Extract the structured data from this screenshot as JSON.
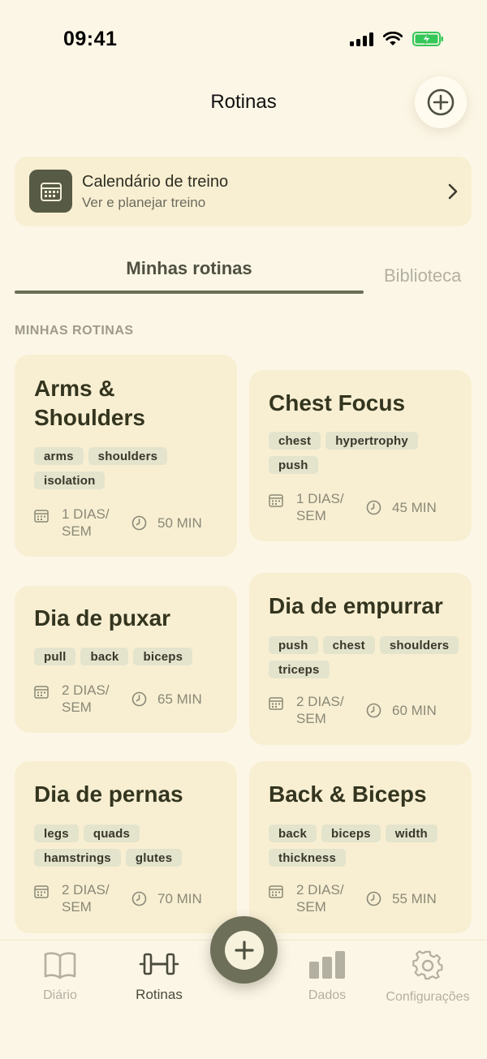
{
  "status_bar": {
    "time": "09:41"
  },
  "header": {
    "title": "Rotinas"
  },
  "calendar_card": {
    "title": "Calendário de treino",
    "subtitle": "Ver e planejar treino"
  },
  "tabs": {
    "mine": "Minhas rotinas",
    "library": "Biblioteca"
  },
  "section_label": "MINHAS ROTINAS",
  "routines": [
    {
      "title": "Arms &\nShoulders",
      "tags": [
        "arms",
        "shoulders",
        "isolation"
      ],
      "days": "1 DIAS/\nSEM",
      "minutes": "50 MIN"
    },
    {
      "title": "Chest Focus",
      "tags": [
        "chest",
        "hypertrophy",
        "push"
      ],
      "days": "1 DIAS/\nSEM",
      "minutes": "45 MIN"
    },
    {
      "title": "Dia de puxar",
      "tags": [
        "pull",
        "back",
        "biceps"
      ],
      "days": "2 DIAS/\nSEM",
      "minutes": "65 MIN"
    },
    {
      "title": "Dia de empurrar",
      "tags": [
        "push",
        "chest",
        "shoulders",
        "triceps"
      ],
      "days": "2 DIAS/\nSEM",
      "minutes": "60 MIN"
    },
    {
      "title": "Dia de pernas",
      "tags": [
        "legs",
        "quads",
        "hamstrings",
        "glutes"
      ],
      "days": "2 DIAS/\nSEM",
      "minutes": "70 MIN"
    },
    {
      "title": "Back & Biceps",
      "tags": [
        "back",
        "biceps",
        "width",
        "thickness"
      ],
      "days": "2 DIAS/\nSEM",
      "minutes": "55 MIN"
    }
  ],
  "bottom_nav": {
    "items": [
      {
        "label": "Diário",
        "icon": "book-icon"
      },
      {
        "label": "Rotinas",
        "icon": "dumbbell-icon",
        "active": true
      },
      {
        "label": "Dados",
        "icon": "bar-chart-icon"
      },
      {
        "label": "Configurações",
        "icon": "gear-icon"
      }
    ]
  },
  "colors": {
    "background": "#fcf6e6",
    "card": "#f8efd3",
    "accent": "#6d6f59",
    "tag": "#e4e3cc",
    "battery": "#34c759"
  }
}
